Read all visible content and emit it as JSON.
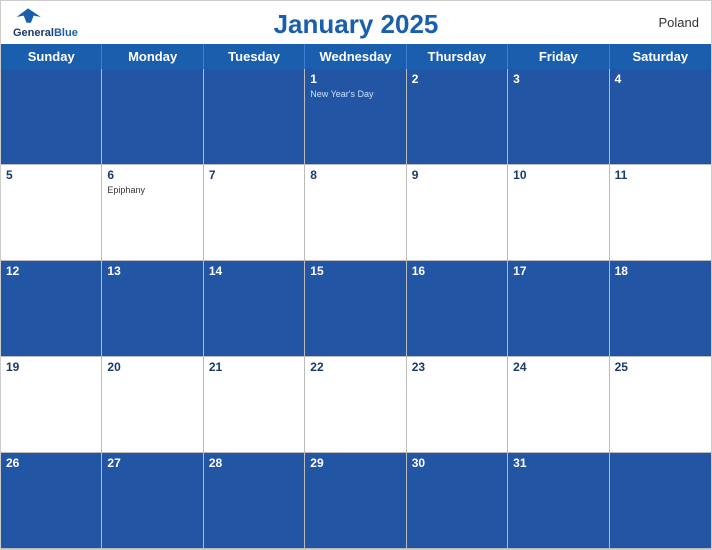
{
  "title": "January 2025",
  "country": "Poland",
  "logo": {
    "line1": "General",
    "line2": "Blue"
  },
  "days_of_week": [
    "Sunday",
    "Monday",
    "Tuesday",
    "Wednesday",
    "Thursday",
    "Friday",
    "Saturday"
  ],
  "weeks": [
    [
      {
        "date": "",
        "holiday": "",
        "empty": true
      },
      {
        "date": "",
        "holiday": "",
        "empty": true
      },
      {
        "date": "",
        "holiday": "",
        "empty": true
      },
      {
        "date": "1",
        "holiday": "New Year's Day",
        "empty": false
      },
      {
        "date": "2",
        "holiday": "",
        "empty": false
      },
      {
        "date": "3",
        "holiday": "",
        "empty": false
      },
      {
        "date": "4",
        "holiday": "",
        "empty": false
      }
    ],
    [
      {
        "date": "5",
        "holiday": "",
        "empty": false
      },
      {
        "date": "6",
        "holiday": "Epiphany",
        "empty": false
      },
      {
        "date": "7",
        "holiday": "",
        "empty": false
      },
      {
        "date": "8",
        "holiday": "",
        "empty": false
      },
      {
        "date": "9",
        "holiday": "",
        "empty": false
      },
      {
        "date": "10",
        "holiday": "",
        "empty": false
      },
      {
        "date": "11",
        "holiday": "",
        "empty": false
      }
    ],
    [
      {
        "date": "12",
        "holiday": "",
        "empty": false
      },
      {
        "date": "13",
        "holiday": "",
        "empty": false
      },
      {
        "date": "14",
        "holiday": "",
        "empty": false
      },
      {
        "date": "15",
        "holiday": "",
        "empty": false
      },
      {
        "date": "16",
        "holiday": "",
        "empty": false
      },
      {
        "date": "17",
        "holiday": "",
        "empty": false
      },
      {
        "date": "18",
        "holiday": "",
        "empty": false
      }
    ],
    [
      {
        "date": "19",
        "holiday": "",
        "empty": false
      },
      {
        "date": "20",
        "holiday": "",
        "empty": false
      },
      {
        "date": "21",
        "holiday": "",
        "empty": false
      },
      {
        "date": "22",
        "holiday": "",
        "empty": false
      },
      {
        "date": "23",
        "holiday": "",
        "empty": false
      },
      {
        "date": "24",
        "holiday": "",
        "empty": false
      },
      {
        "date": "25",
        "holiday": "",
        "empty": false
      }
    ],
    [
      {
        "date": "26",
        "holiday": "",
        "empty": false
      },
      {
        "date": "27",
        "holiday": "",
        "empty": false
      },
      {
        "date": "28",
        "holiday": "",
        "empty": false
      },
      {
        "date": "29",
        "holiday": "",
        "empty": false
      },
      {
        "date": "30",
        "holiday": "",
        "empty": false
      },
      {
        "date": "31",
        "holiday": "",
        "empty": false
      },
      {
        "date": "",
        "holiday": "",
        "empty": true
      }
    ]
  ],
  "accent_color": "#1a5fad",
  "header_bg": "#2255a4"
}
